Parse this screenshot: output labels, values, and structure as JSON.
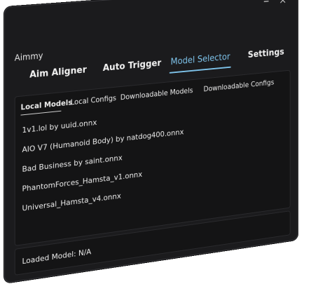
{
  "window": {
    "title": "Aimmy",
    "controls": {
      "minimize_icon": "minimize-icon",
      "close_icon": "close-icon"
    }
  },
  "nav": {
    "tabs": [
      {
        "label": "Aim Aligner",
        "active": false
      },
      {
        "label": "Auto Trigger",
        "active": false
      },
      {
        "label": "Model Selector",
        "active": true
      },
      {
        "label": "Settings",
        "active": false
      }
    ],
    "accent_color": "#7ec3ea"
  },
  "subtabs": [
    {
      "label": "Local Models",
      "active": true
    },
    {
      "label": "Local Configs",
      "active": false
    },
    {
      "label": "Downloadable Models",
      "active": false
    },
    {
      "label": "Downloadable Configs",
      "active": false
    }
  ],
  "models": [
    "1v1.lol by uuid.onnx",
    "AIO V7 (Humanoid Body) by natdog400.onnx",
    "Bad Business by saint.onnx",
    "PhantomForces_Hamsta_v1.onnx",
    "Universal_Hamsta_v4.onnx"
  ],
  "status": {
    "loaded_model": "Loaded Model: N/A"
  }
}
